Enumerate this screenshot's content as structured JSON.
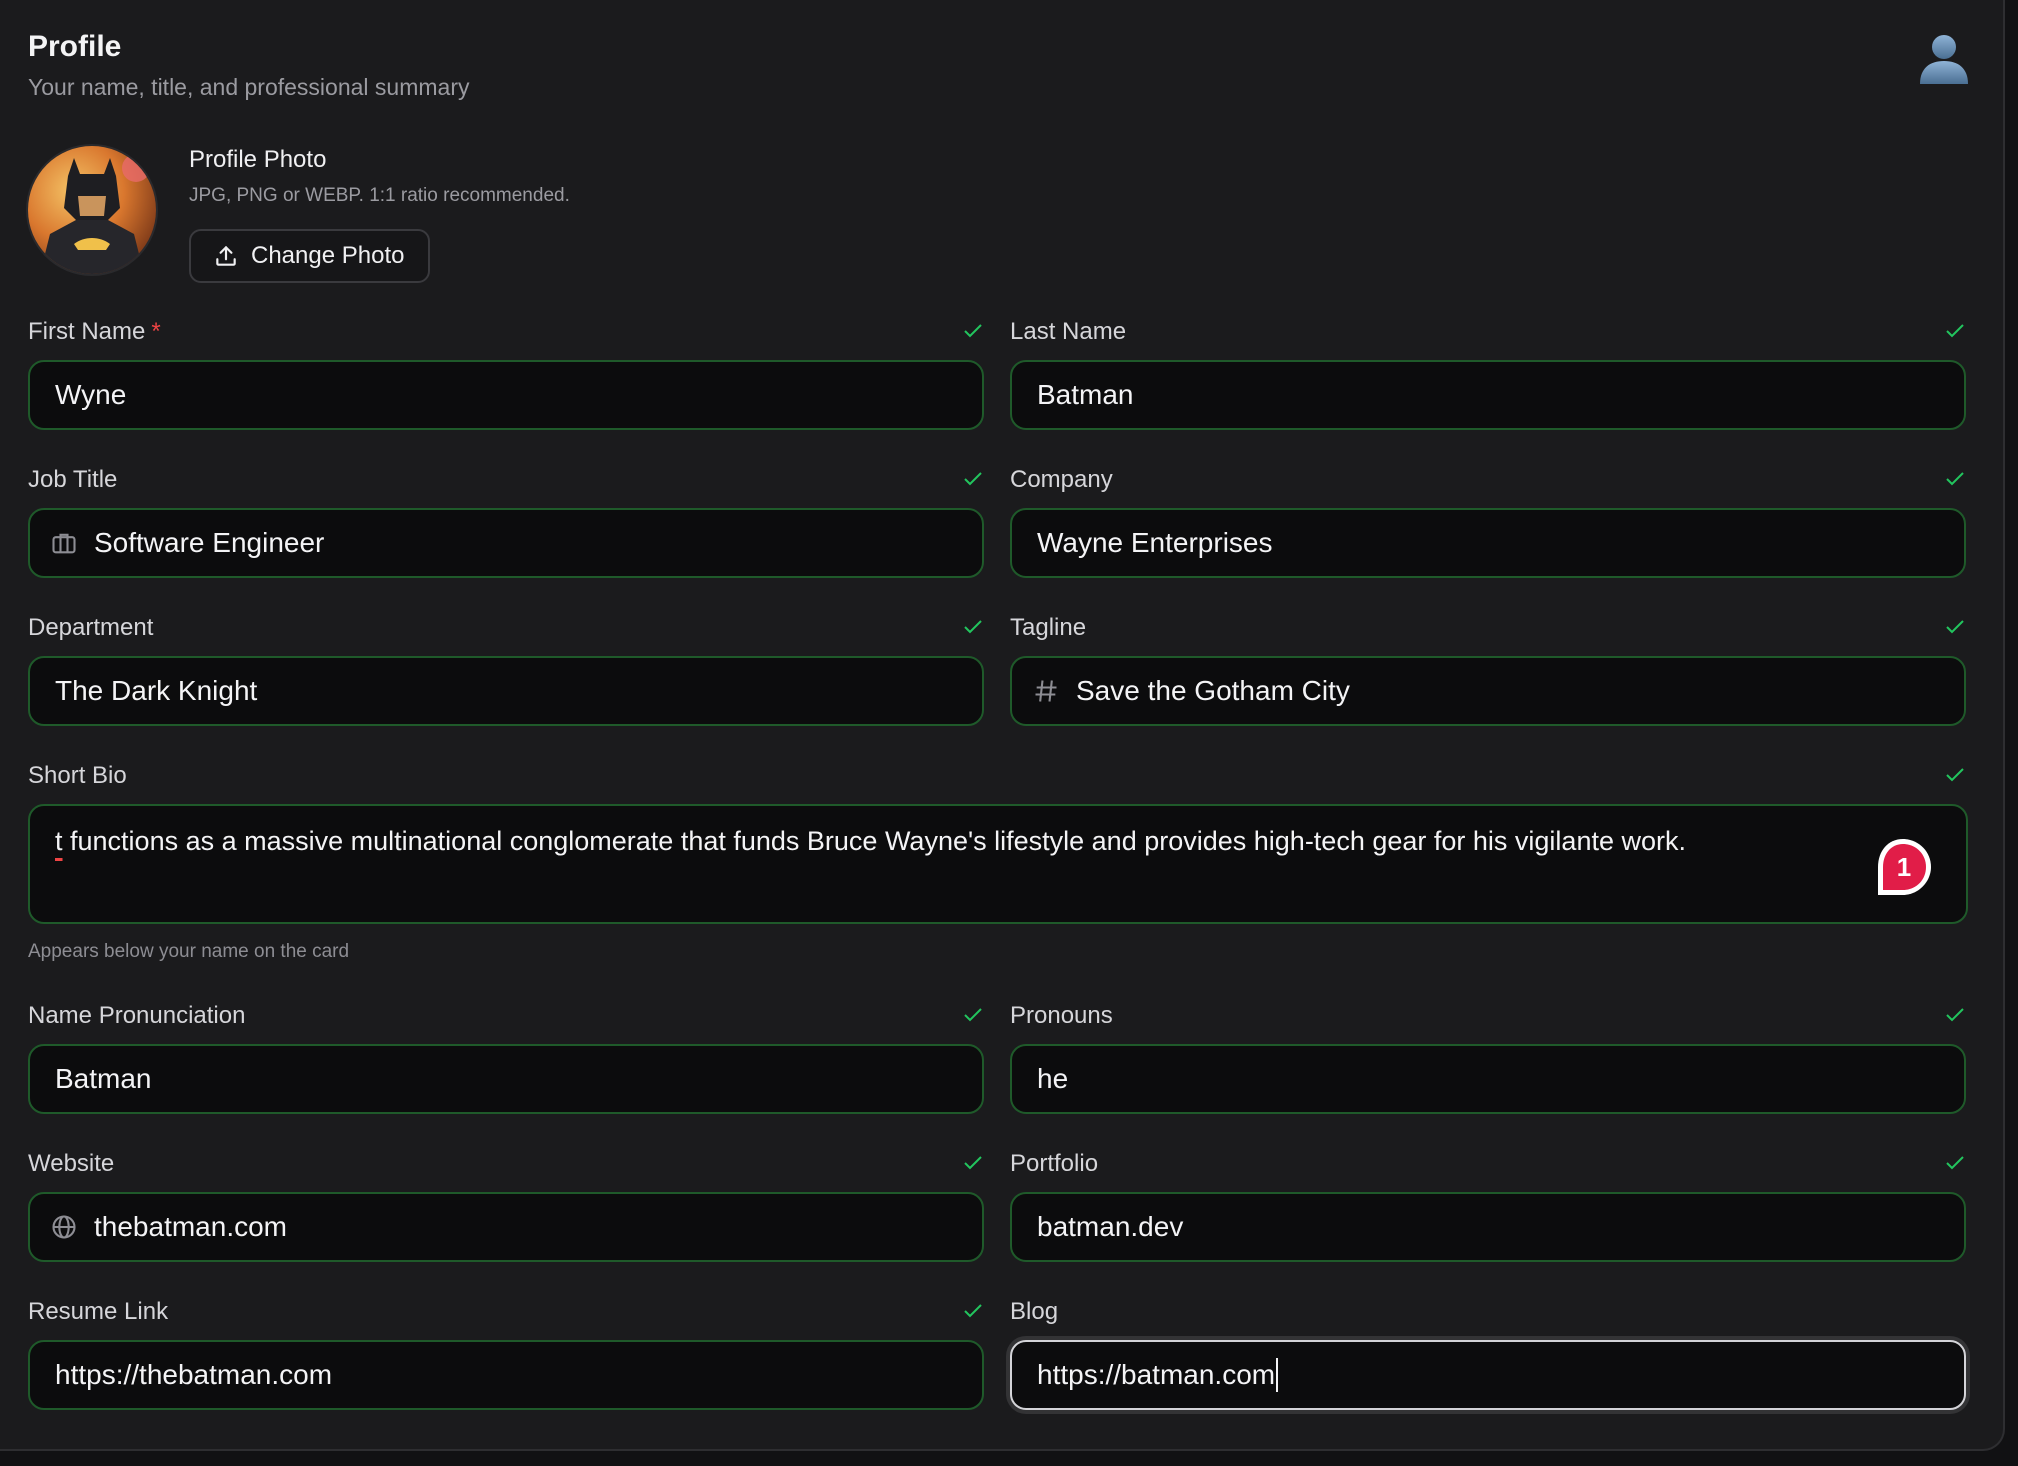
{
  "header": {
    "title": "Profile",
    "subtitle": "Your name, title, and professional summary",
    "user_icon": "user-icon"
  },
  "photo": {
    "title": "Profile Photo",
    "hint": "JPG, PNG or WEBP. 1:1 ratio recommended.",
    "button_label": "Change Photo",
    "button_icon": "upload-icon"
  },
  "fields": {
    "first_name": {
      "label": "First Name",
      "required_mark": "*",
      "value": "Wyne"
    },
    "last_name": {
      "label": "Last Name",
      "value": "Batman"
    },
    "job_title": {
      "label": "Job Title",
      "value": "Software Engineer",
      "icon": "briefcase-icon"
    },
    "company": {
      "label": "Company",
      "value": "Wayne Enterprises"
    },
    "department": {
      "label": "Department",
      "value": "The Dark Knight"
    },
    "tagline": {
      "label": "Tagline",
      "value": "Save the Gotham City",
      "icon": "hash-icon"
    },
    "short_bio": {
      "label": "Short Bio",
      "value_first": "t",
      "value_rest": " functions as a massive multinational conglomerate that funds Bruce Wayne's lifestyle and provides high-tech gear for his vigilante work.",
      "helper": "Appears below your name on the card",
      "badge_count": "1"
    },
    "name_pronunciation": {
      "label": "Name Pronunciation",
      "value": "Batman"
    },
    "pronouns": {
      "label": "Pronouns",
      "value": "he"
    },
    "website": {
      "label": "Website",
      "value": "thebatman.com",
      "icon": "globe-icon"
    },
    "portfolio": {
      "label": "Portfolio",
      "value": "batman.dev"
    },
    "resume_link": {
      "label": "Resume Link",
      "value": "https://thebatman.com"
    },
    "blog": {
      "label": "Blog",
      "value": "https://batman.com"
    }
  },
  "colors": {
    "valid_border": "#1f5a2a",
    "check": "#22c55e",
    "required": "#ef4444",
    "badge": "#e11d48"
  }
}
